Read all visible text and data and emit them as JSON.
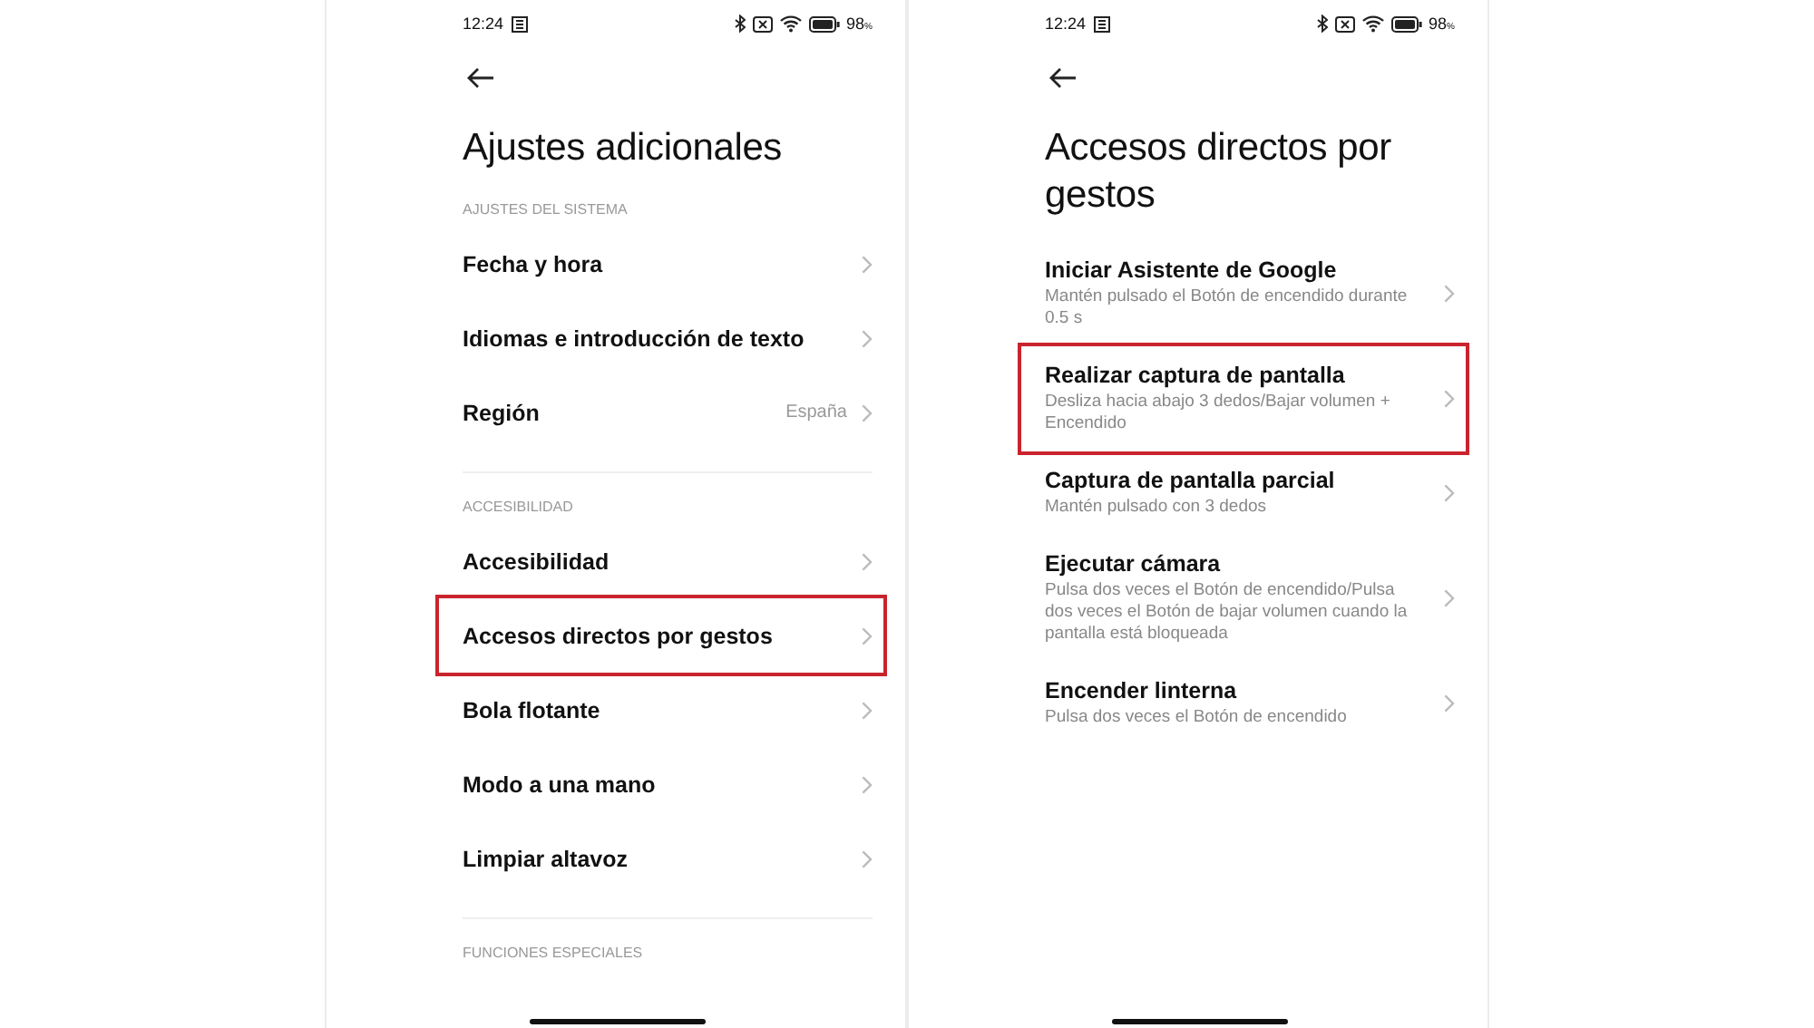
{
  "screens": [
    {
      "status_bar": {
        "time": "12:24",
        "battery": "98",
        "percent": "%"
      },
      "title": "Ajustes adicionales",
      "sections": [
        {
          "label": "AJUSTES DEL SISTEMA",
          "items": [
            {
              "title": "Fecha y hora",
              "highlighted": false
            },
            {
              "title": "Idiomas e introducción de texto",
              "highlighted": false
            },
            {
              "title": "Región",
              "value": "España",
              "highlighted": false
            }
          ]
        },
        {
          "label": "ACCESIBILIDAD",
          "items": [
            {
              "title": "Accesibilidad",
              "highlighted": false
            },
            {
              "title": "Accesos directos por gestos",
              "highlighted": true
            },
            {
              "title": "Bola flotante",
              "highlighted": false
            },
            {
              "title": "Modo a una mano",
              "highlighted": false
            },
            {
              "title": "Limpiar altavoz",
              "highlighted": false
            }
          ]
        },
        {
          "label": "FUNCIONES ESPECIALES"
        }
      ]
    },
    {
      "status_bar": {
        "time": "12:24",
        "battery": "98",
        "percent": "%"
      },
      "title": "Accesos directos por gestos",
      "sections": [
        {
          "items": [
            {
              "title": "Iniciar Asistente de Google",
              "subtitle": "Mantén pulsado el Botón de encendido durante 0.5 s",
              "highlighted": false
            },
            {
              "title": "Realizar captura de pantalla",
              "subtitle": "Desliza hacia abajo 3 dedos/Bajar volumen + Encendido",
              "highlighted": true
            },
            {
              "title": "Captura de pantalla parcial",
              "subtitle": "Mantén pulsado con 3 dedos",
              "highlighted": false
            },
            {
              "title": "Ejecutar cámara",
              "subtitle": "Pulsa dos veces el Botón de encendido/Pulsa dos veces el Botón de bajar volumen cuando la pantalla está bloqueada",
              "highlighted": false
            },
            {
              "title": "Encender linterna",
              "subtitle": "Pulsa dos veces el Botón de encendido",
              "highlighted": false
            }
          ]
        }
      ]
    }
  ]
}
